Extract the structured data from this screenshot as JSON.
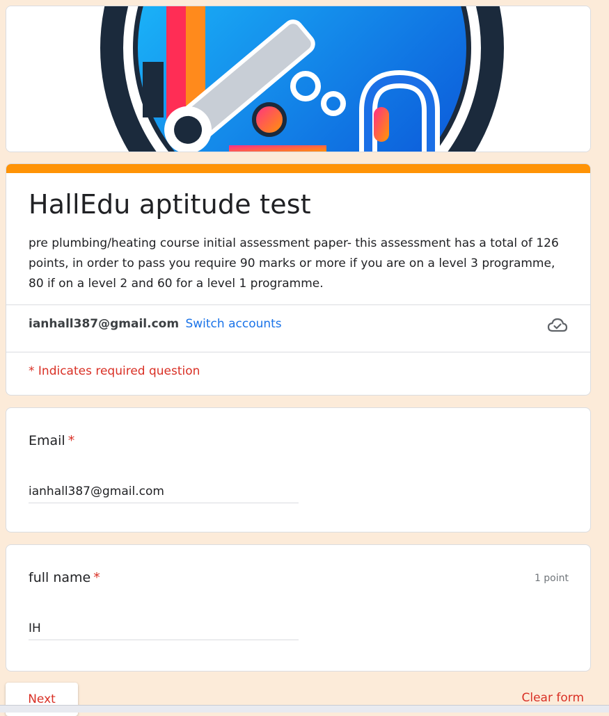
{
  "colors": {
    "page_background": "#fcebd9",
    "accent": "#ff9306",
    "link": "#1a73e8",
    "required": "#d93025"
  },
  "header": {
    "banner_image": "plumbing-wrench-gear-logo"
  },
  "form": {
    "title": "HallEdu aptitude test",
    "description": "pre plumbing/heating course initial assessment paper- this assessment has a total of 126 points, in order to pass you require 90 marks or more if you are on a level 3 programme, 80 if on a level 2 and 60 for a level 1 programme.",
    "account_email": "ianhall387@gmail.com",
    "switch_accounts": "Switch accounts",
    "save_status_icon": "cloud-saved-icon",
    "required_note": "* Indicates required question"
  },
  "questions": [
    {
      "label": "Email",
      "required_mark": "*",
      "points": "",
      "value": "ianhall387@gmail.com"
    },
    {
      "label": "full name",
      "required_mark": "*",
      "points": "1 point",
      "value": "IH"
    }
  ],
  "footer": {
    "next_label": "Next",
    "clear_label": "Clear form"
  }
}
